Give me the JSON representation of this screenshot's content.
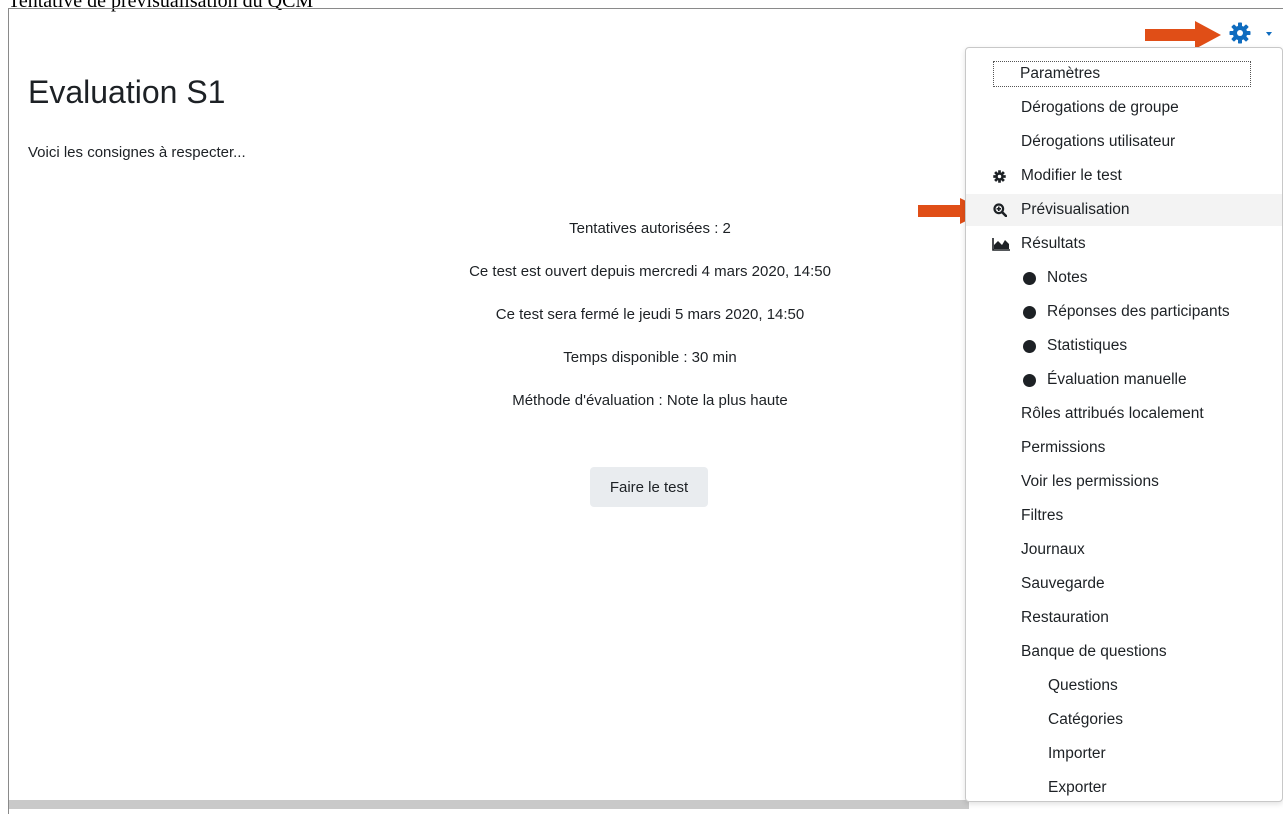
{
  "caption": "Tentative de prévisualisation du QCM",
  "page": {
    "title": "Evaluation S1",
    "intro": "Voici les consignes à respecter...",
    "info": [
      "Tentatives autorisées : 2",
      "Ce test est ouvert depuis mercredi 4 mars 2020, 14:50",
      "Ce test sera fermé le jeudi 5 mars 2020, 14:50",
      "Temps disponible : 30 min",
      "Méthode d'évaluation : Note la plus haute"
    ],
    "start_button": "Faire le test"
  },
  "colors": {
    "accent": "#0f6cbf",
    "arrow": "#e04e17"
  },
  "menu": {
    "items": [
      {
        "label": "Paramètres",
        "icon": null,
        "level": 0
      },
      {
        "label": "Dérogations de groupe",
        "icon": null,
        "level": 0
      },
      {
        "label": "Dérogations utilisateur",
        "icon": null,
        "level": 0
      },
      {
        "label": "Modifier le test",
        "icon": "gear-icon",
        "level": 0
      },
      {
        "label": "Prévisualisation",
        "icon": "zoom-icon",
        "level": 0
      },
      {
        "label": "Résultats",
        "icon": "chart-icon",
        "level": 0
      },
      {
        "label": "Notes",
        "icon": "bullet",
        "level": 1
      },
      {
        "label": "Réponses des participants",
        "icon": "bullet",
        "level": 1
      },
      {
        "label": "Statistiques",
        "icon": "bullet",
        "level": 1
      },
      {
        "label": "Évaluation manuelle",
        "icon": "bullet",
        "level": 1
      },
      {
        "label": "Rôles attribués localement",
        "icon": null,
        "level": 0
      },
      {
        "label": "Permissions",
        "icon": null,
        "level": 0
      },
      {
        "label": "Voir les permissions",
        "icon": null,
        "level": 0
      },
      {
        "label": "Filtres",
        "icon": null,
        "level": 0
      },
      {
        "label": "Journaux",
        "icon": null,
        "level": 0
      },
      {
        "label": "Sauvegarde",
        "icon": null,
        "level": 0
      },
      {
        "label": "Restauration",
        "icon": null,
        "level": 0
      },
      {
        "label": "Banque de questions",
        "icon": null,
        "level": 0
      },
      {
        "label": "Questions",
        "icon": null,
        "level": 2
      },
      {
        "label": "Catégories",
        "icon": null,
        "level": 2
      },
      {
        "label": "Importer",
        "icon": null,
        "level": 2
      },
      {
        "label": "Exporter",
        "icon": null,
        "level": 2
      }
    ]
  }
}
